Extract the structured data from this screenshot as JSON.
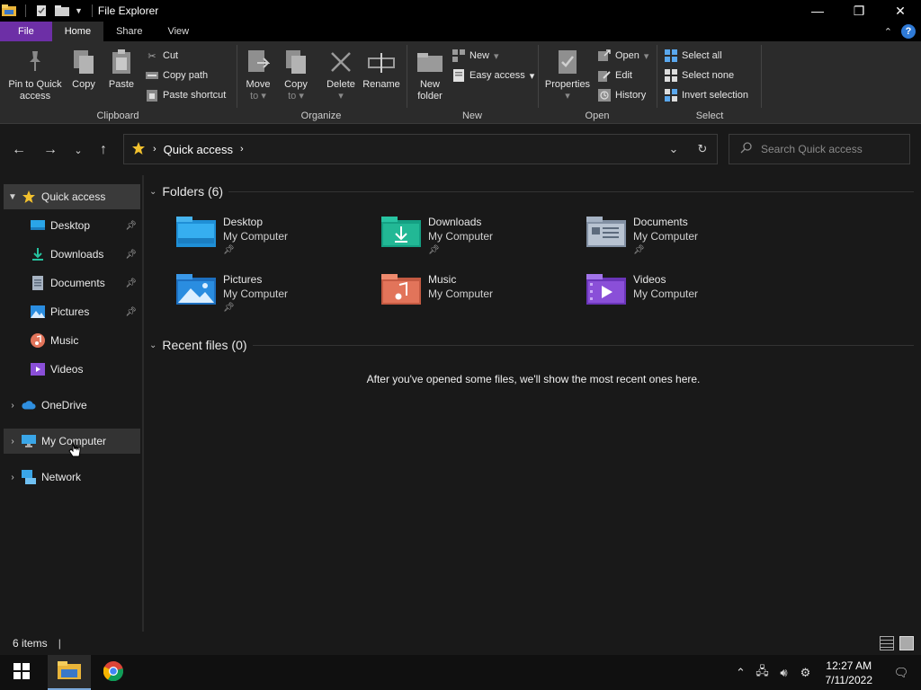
{
  "window": {
    "title": "File Explorer"
  },
  "ribbon_tabs": [
    "File",
    "Home",
    "Share",
    "View"
  ],
  "ribbon": {
    "clipboard": {
      "label": "Clipboard",
      "pin": "Pin to Quick access",
      "pin_line1": "Pin to Quick",
      "pin_line2": "access",
      "copy": "Copy",
      "paste": "Paste",
      "cut": "Cut",
      "copy_path": "Copy path",
      "paste_shortcut": "Paste shortcut"
    },
    "organize": {
      "label": "Organize",
      "move_l1": "Move",
      "move_l2": "to",
      "copy_l1": "Copy",
      "copy_l2": "to",
      "delete": "Delete",
      "rename": "Rename"
    },
    "new": {
      "label": "New",
      "new_folder_l1": "New",
      "new_folder_l2": "folder",
      "new_item": "New",
      "easy_access": "Easy access"
    },
    "open": {
      "label": "Open",
      "properties": "Properties",
      "open": "Open",
      "edit": "Edit",
      "history": "History"
    },
    "select": {
      "label": "Select",
      "select_all": "Select all",
      "select_none": "Select none",
      "invert": "Invert selection"
    }
  },
  "address": {
    "location": "Quick access",
    "search_placeholder": "Search Quick access"
  },
  "nav": {
    "quick_access": "Quick access",
    "items": [
      {
        "label": "Desktop",
        "icon": "desktop-icon",
        "pinned": true
      },
      {
        "label": "Downloads",
        "icon": "downloads-icon",
        "pinned": true
      },
      {
        "label": "Documents",
        "icon": "documents-icon",
        "pinned": true
      },
      {
        "label": "Pictures",
        "icon": "pictures-icon",
        "pinned": true
      },
      {
        "label": "Music",
        "icon": "music-icon",
        "pinned": false
      },
      {
        "label": "Videos",
        "icon": "videos-icon",
        "pinned": false
      }
    ],
    "onedrive": "OneDrive",
    "my_computer": "My Computer",
    "network": "Network"
  },
  "content": {
    "folders_header": "Folders (6)",
    "folders": [
      {
        "name": "Desktop",
        "location": "My Computer",
        "pinned": true,
        "color": "#2aa5e8"
      },
      {
        "name": "Downloads",
        "location": "My Computer",
        "pinned": true,
        "color": "#1fb79a"
      },
      {
        "name": "Documents",
        "location": "My Computer",
        "pinned": true,
        "color": "#9aa7b8"
      },
      {
        "name": "Pictures",
        "location": "My Computer",
        "pinned": true,
        "color": "#2a8de0"
      },
      {
        "name": "Music",
        "location": "My Computer",
        "pinned": false,
        "color": "#e2745a"
      },
      {
        "name": "Videos",
        "location": "My Computer",
        "pinned": false,
        "color": "#8a4fd8"
      }
    ],
    "recent_header": "Recent files (0)",
    "recent_empty": "After you've opened some files, we'll show the most recent ones here."
  },
  "status": {
    "item_count": "6 items"
  },
  "taskbar": {
    "time": "12:27 AM",
    "date": "7/11/2022"
  },
  "colors": {
    "file_tab": "#6d2fa6",
    "accent_blue": "#2f7ad6",
    "background": "#191919",
    "ribbon": "#2b2b2b"
  }
}
